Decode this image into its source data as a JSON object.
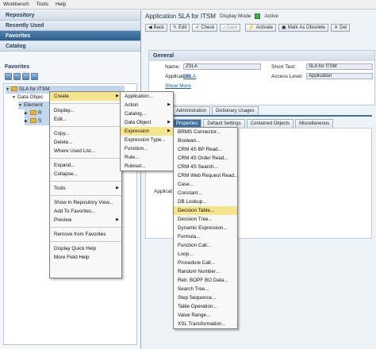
{
  "menubar": {
    "items": [
      "Workbench",
      "Tools",
      "Help"
    ]
  },
  "left": {
    "accordion": [
      "Repository",
      "Recently Used",
      "Favorites",
      "Catalog"
    ],
    "active_accordion": "Favorites",
    "favorites_title": "Favorites",
    "tree": {
      "root": "SLA for ITSM",
      "child1": "Data Objec",
      "child2": "Element",
      "child3": "R",
      "child4": "S"
    }
  },
  "right": {
    "title": "Application SLA for ITSM",
    "mode": "Display Mode",
    "status": "Active",
    "toolbar": {
      "back": "Back",
      "edit": "Edit",
      "check": "Check",
      "save": "Save",
      "activate": "Activate",
      "mark_obsolete": "Mark As Obsolete",
      "delete": "Del"
    },
    "general": {
      "header": "General",
      "name_label": "Name:",
      "name_value": "ZSLA",
      "short_text_label": "Short Text:",
      "short_text_value": "SLA for ITSM",
      "application_label": "Application:",
      "application_value": "ZSLA",
      "access_level_label": "Access Level:",
      "access_level_value": "Application",
      "show_more": "Show More"
    },
    "tabs_top": [
      "Administration",
      "Dictionary Usages"
    ],
    "tabs_bottom": [
      "Properties",
      "Default Settings",
      "Contained Objects",
      "Miscellaneous"
    ],
    "applic_label": "Applicat"
  },
  "context_menu": {
    "items": [
      "Create",
      "Display...",
      "Edit...",
      "Copy...",
      "Delete...",
      "Where Used List...",
      "Expand...",
      "Collapse...",
      "Tools",
      "Show In Repository View...",
      "Add To Favorites...",
      "Preview",
      "Remove from Favorites",
      "Display Quick Help",
      "More Field Help"
    ]
  },
  "create_menu": {
    "items": [
      "Application...",
      "Action",
      "Catalog...",
      "Data Object",
      "Expression",
      "Expression Type...",
      "Function...",
      "Rule...",
      "Ruleset..."
    ]
  },
  "expression_menu": {
    "items": [
      "BRMS Connector...",
      "Boolean...",
      "CRM 4S BP Read...",
      "CRM 4S Order Read...",
      "CRM 4S Search...",
      "CRM Web Request Read...",
      "Case...",
      "Constant...",
      "DB Lookup...",
      "Decision Table...",
      "Decision Tree...",
      "Dynamic Expression...",
      "Formula...",
      "Function Call...",
      "Loop...",
      "Procedure Call...",
      "Random Number...",
      "Retr. BOPF BO Data...",
      "Search Tree...",
      "Step Sequence...",
      "Table Operation...",
      "Value Range...",
      "XSL Transformation..."
    ]
  }
}
